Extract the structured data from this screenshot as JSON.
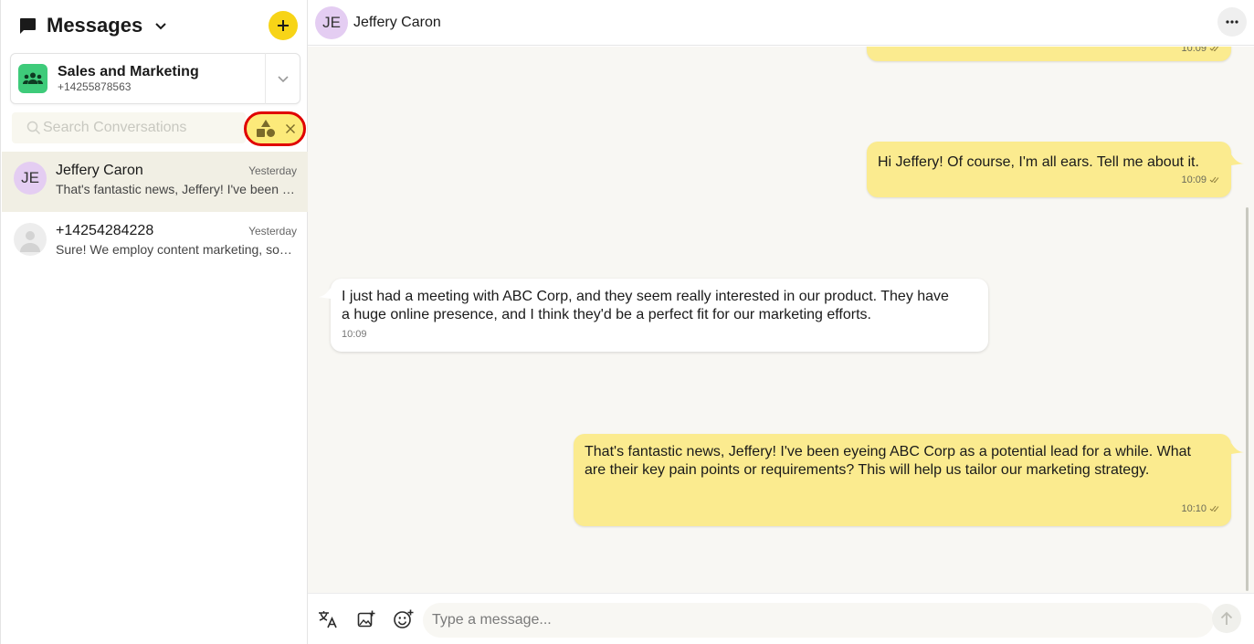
{
  "sidebar": {
    "title": "Messages",
    "icons": {
      "title": "chat-bubble-icon",
      "dropdown": "chevron-down-icon",
      "add": "plus-icon"
    },
    "account": {
      "name": "Sales and Marketing",
      "phone": "+14255878563",
      "icon": "group-icon"
    },
    "search": {
      "placeholder": "Search Conversations",
      "value": "",
      "filter_icon": "shapes-filter-icon",
      "clear_icon": "close-icon"
    },
    "conversations": [
      {
        "avatar": "JE",
        "avatar_color": "#e4cdf2",
        "name": "Jeffery Caron",
        "time": "Yesterday",
        "preview": "That's fantastic news, Jeffery! I've been eyeing ABC Corp as a potential lead for a while.",
        "active": true
      },
      {
        "avatar": "",
        "avatar_icon": "person-placeholder-icon",
        "name": "+14254284228",
        "time": "Yesterday",
        "preview": "Sure! We employ content marketing, social media and email campaigns.",
        "active": false
      }
    ]
  },
  "chat": {
    "contact_initials": "JE",
    "contact_name": "Jeffery Caron",
    "more_icon": "more-horizontal-icon",
    "messages": [
      {
        "direction": "out",
        "text": "",
        "time": "10:09",
        "status_icon": "double-check-icon"
      },
      {
        "direction": "out",
        "text": "Hi Jeffery! Of course, I'm all ears. Tell me about it.",
        "time": "10:09",
        "status_icon": "double-check-icon"
      },
      {
        "direction": "in",
        "text": "I just had a meeting with ABC Corp, and they seem really interested in our product. They have a huge online presence, and I think they'd be a perfect fit for our marketing efforts.",
        "time": "10:09"
      },
      {
        "direction": "out",
        "text": "That's fantastic news, Jeffery! I've been eyeing ABC Corp as a potential lead for a while. What are their key pain points or requirements? This will help us tailor our marketing strategy.",
        "time": "10:10",
        "status_icon": "double-check-icon"
      }
    ]
  },
  "composer": {
    "placeholder": "Type a message...",
    "value": "",
    "tools": [
      "translate-icon",
      "image-add-icon",
      "emoji-add-icon"
    ],
    "send_icon": "arrow-up-icon"
  },
  "colors": {
    "accent": "#f7d417",
    "outgoing_bubble": "#fbeb8f",
    "incoming_bubble": "#ffffff",
    "chat_background": "#f8f7f3",
    "filter_highlight_ring": "#e00000",
    "group_icon_bg": "#3ecb7a"
  }
}
